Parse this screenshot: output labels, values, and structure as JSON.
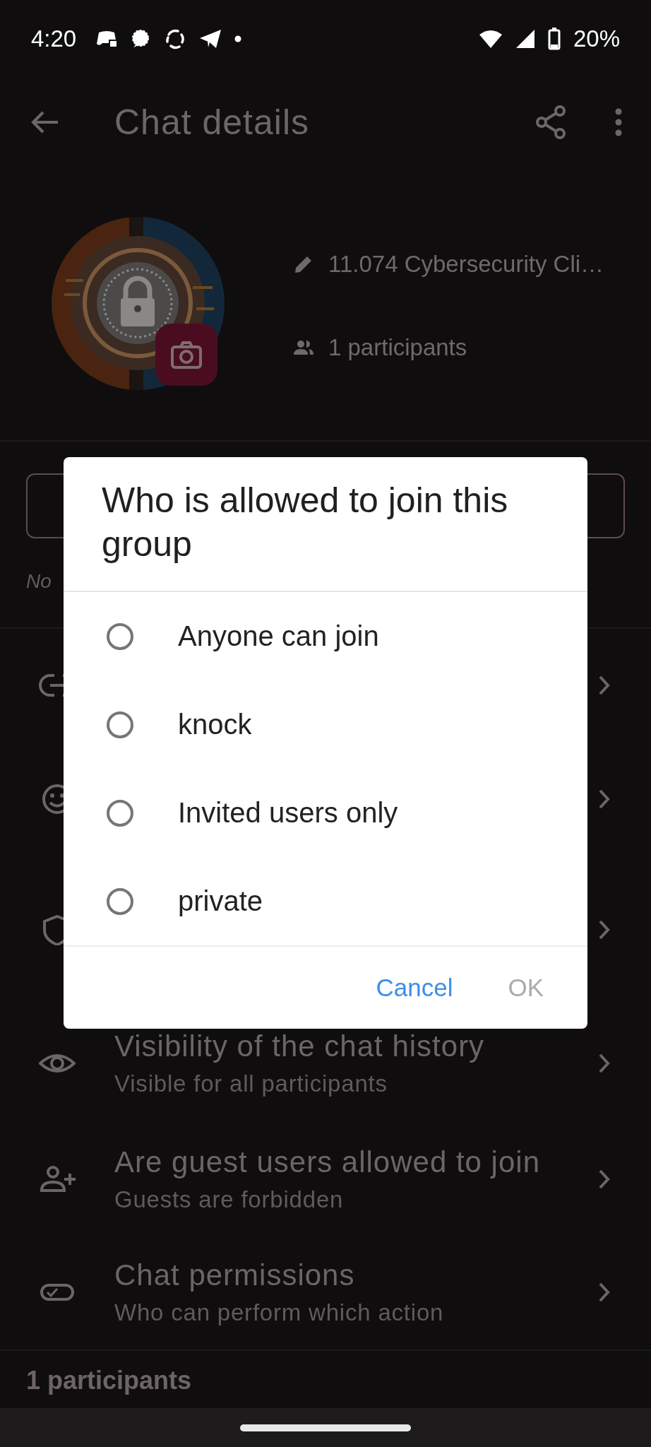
{
  "status_bar": {
    "time": "4:20",
    "battery": "20%"
  },
  "app_bar": {
    "title": "Chat details"
  },
  "profile": {
    "name": "11.074 Cybersecurity Cli…",
    "participants": "1 participants"
  },
  "description_hint": "No",
  "settings": [
    {
      "kind": "link"
    },
    {
      "kind": "emoji"
    },
    {
      "kind": "shield"
    },
    {
      "kind": "eye",
      "title": "Visibility of the chat history",
      "subtitle": "Visible for all participants"
    },
    {
      "kind": "guest",
      "title": "Are guest users allowed to join",
      "subtitle": "Guests are forbidden"
    },
    {
      "kind": "permissions",
      "title": "Chat permissions",
      "subtitle": "Who can perform which action"
    }
  ],
  "section_title": "1 participants",
  "dialog": {
    "title": "Who is allowed to join this group",
    "options": [
      {
        "label": "Anyone can join",
        "selected": false
      },
      {
        "label": "knock",
        "selected": false
      },
      {
        "label": "Invited users only",
        "selected": false
      },
      {
        "label": "private",
        "selected": false
      }
    ],
    "buttons": [
      {
        "label": "Cancel",
        "disabled": false
      },
      {
        "label": "OK",
        "disabled": true
      }
    ]
  }
}
